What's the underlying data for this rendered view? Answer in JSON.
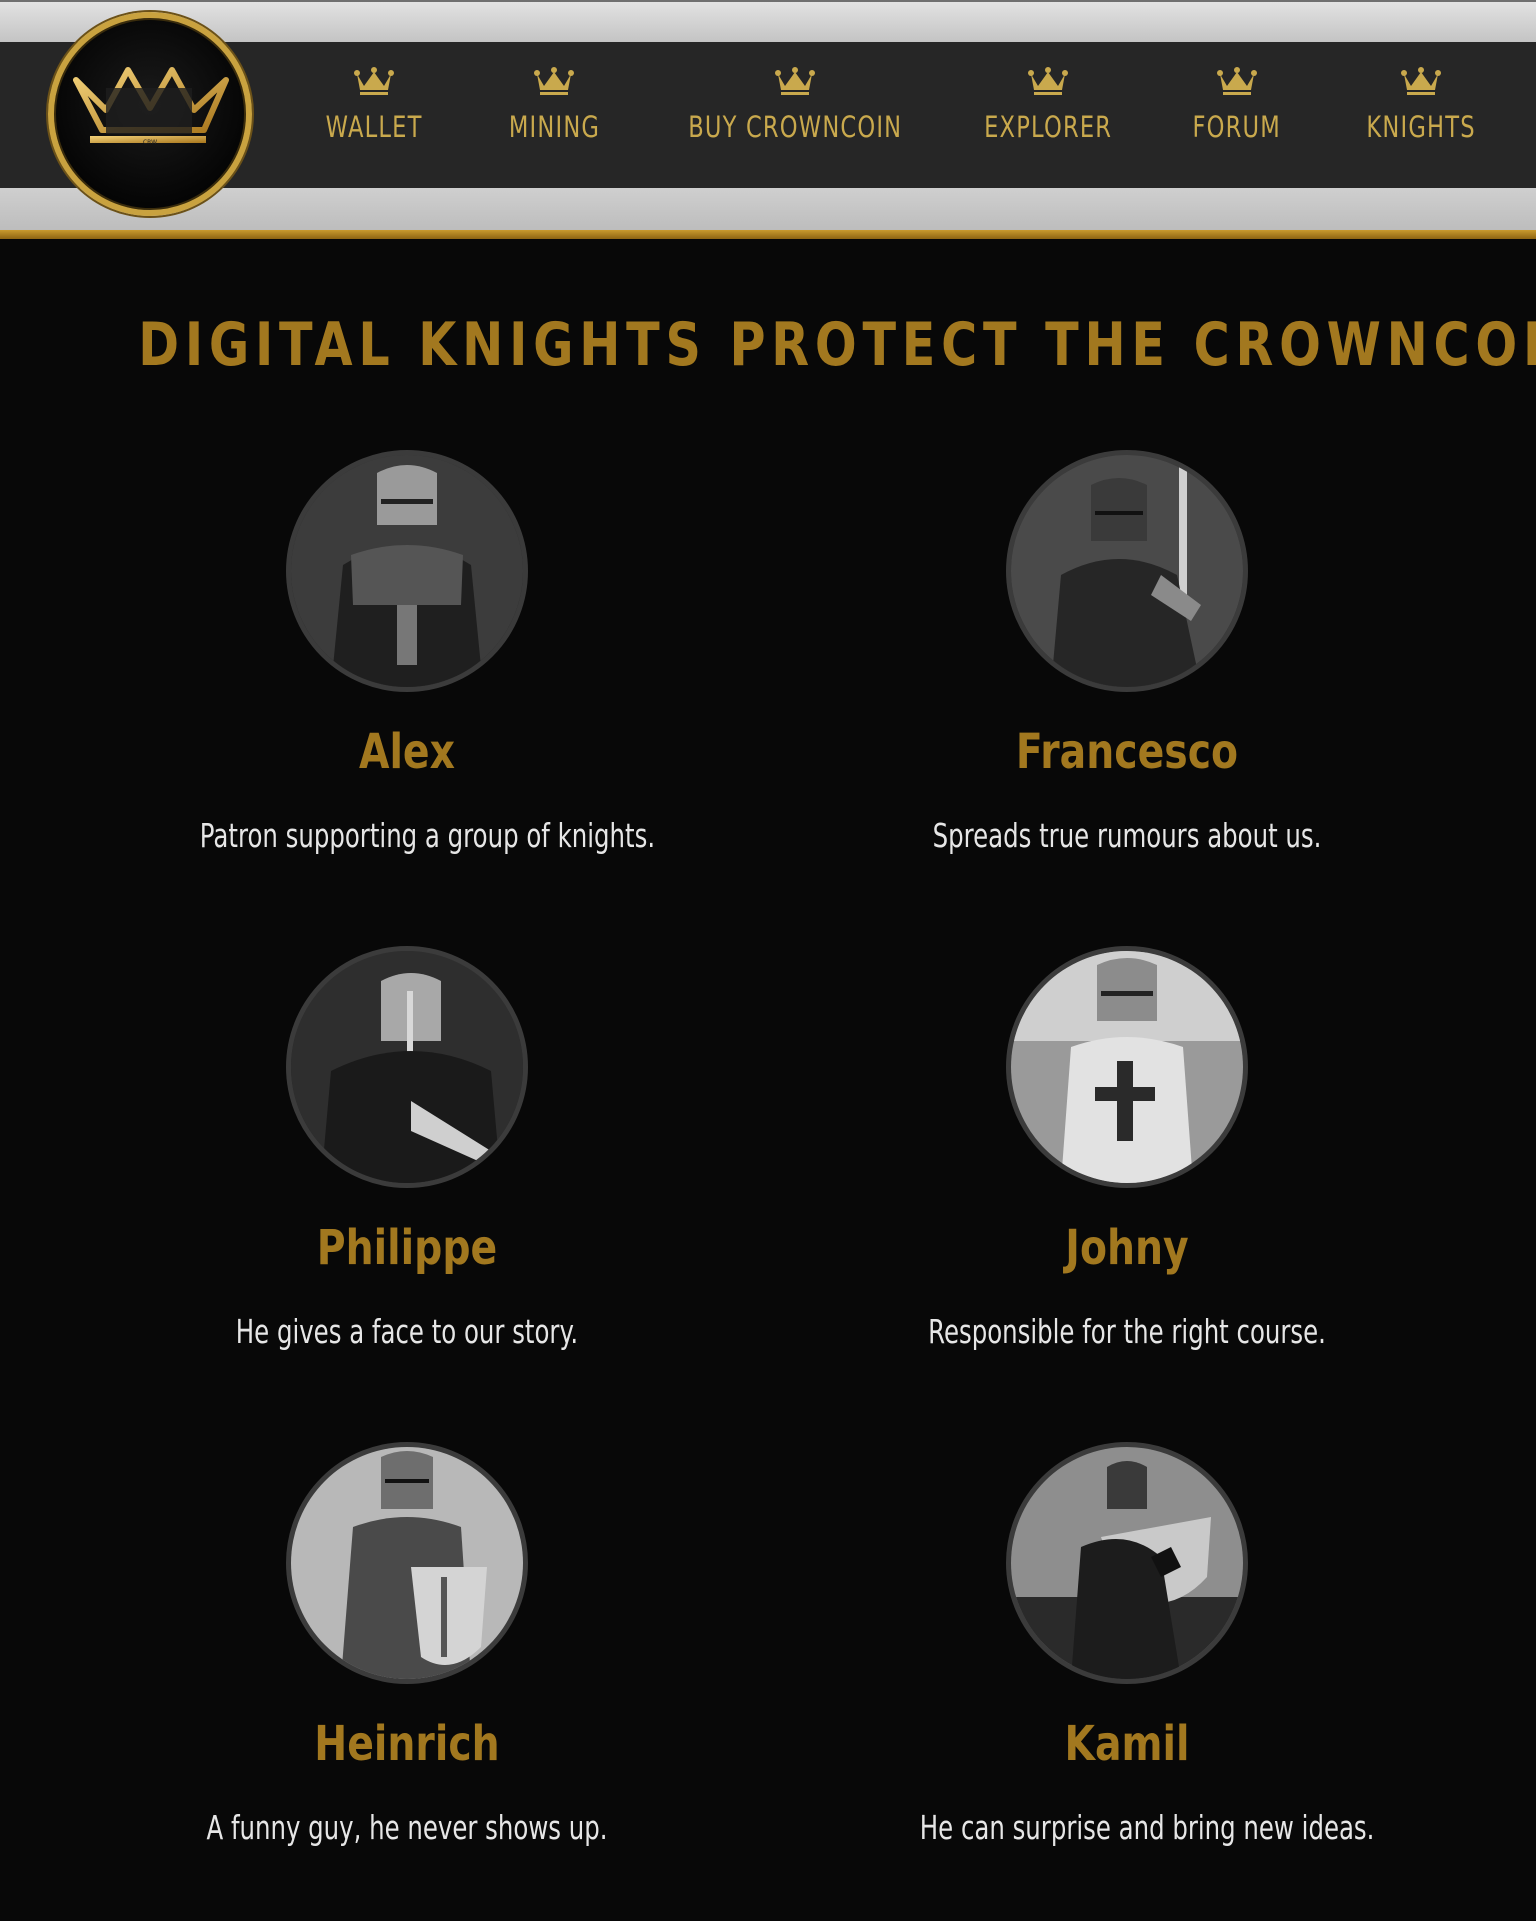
{
  "header": {
    "logo_icon": "crown-logo",
    "nav": [
      {
        "label": "WALLET",
        "icon": "crown-icon"
      },
      {
        "label": "MINING",
        "icon": "crown-icon"
      },
      {
        "label": "BUY CROWNCOIN",
        "icon": "crown-icon"
      },
      {
        "label": "EXPLORER",
        "icon": "crown-icon"
      },
      {
        "label": "FORUM",
        "icon": "crown-icon"
      },
      {
        "label": "KNIGHTS",
        "icon": "crown-icon"
      }
    ]
  },
  "main": {
    "title": "DIGITAL KNIGHTS PROTECT THE CROWNCOIN",
    "knights": [
      {
        "name": "Alex",
        "description": "Patron supporting a group of knights."
      },
      {
        "name": "Francesco",
        "description": "Spreads true rumours about us."
      },
      {
        "name": "Philippe",
        "description": "He gives a face to our story."
      },
      {
        "name": "Johny",
        "description": "Responsible for the right course."
      },
      {
        "name": "Heinrich",
        "description": "A funny guy, he never shows up."
      },
      {
        "name": "Kamil",
        "description": "He can surprise and bring new ideas."
      }
    ]
  },
  "colors": {
    "gold": "#a2781f",
    "nav_gold": "#c9a94d",
    "background": "#080808",
    "navbar": "#262626"
  }
}
